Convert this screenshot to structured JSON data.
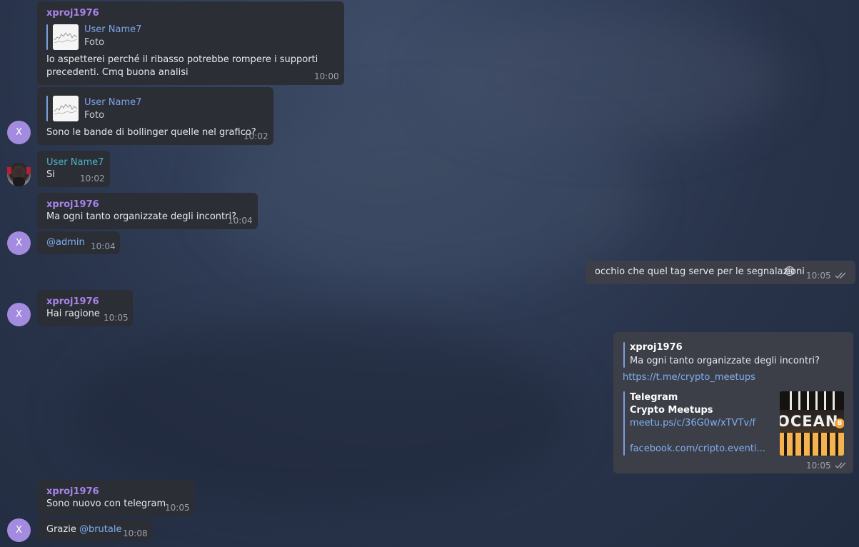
{
  "messages": {
    "m1": {
      "sender": "xproj1976",
      "reply_name": "User Name7",
      "reply_sub": "Foto",
      "line1": "Io aspetterei perché il ribasso potrebbe rompere i supporti",
      "line2": "precedenti. Cmq buona analisi",
      "time": "10:00"
    },
    "m2": {
      "reply_name": "User Name7",
      "reply_sub": "Foto",
      "text": "Sono le bande di bollinger quelle nel grafico?",
      "time": "10:02",
      "avatar": "X"
    },
    "m3": {
      "sender": "User Name7",
      "text": "Si",
      "time": "10:02"
    },
    "m4": {
      "sender": "xproj1976",
      "text": "Ma ogni tanto organizzate degli incontri?",
      "time": "10:04"
    },
    "m5": {
      "text": "@admin",
      "time": "10:04",
      "avatar": "X"
    },
    "m6": {
      "text": "occhio che quel tag serve per le segnalazioni",
      "emoji": "😄",
      "time": "10:05"
    },
    "m7": {
      "sender": "xproj1976",
      "text": "Hai ragione",
      "time": "10:05",
      "avatar": "X"
    },
    "m8": {
      "reply_name": "xproj1976",
      "reply_text": "Ma ogni tanto organizzate degli incontri?",
      "link": "https://t.me/crypto_meetups",
      "preview_site": "Telegram",
      "preview_title": "Crypto Meetups",
      "preview_link1": "meetu.ps/c/36G0w/xTVTv/f",
      "preview_link2": "facebook.com/cripto.eventi...",
      "preview_image_text": "OCEAN",
      "preview_badge": "B",
      "time": "10:05"
    },
    "m9": {
      "sender": "xproj1976",
      "text": "Sono nuovo con telegram",
      "time": "10:05"
    },
    "m10": {
      "text_prefix": "Grazie ",
      "mention": "@brutale",
      "time": "10:08",
      "avatar": "X"
    }
  },
  "colors": {
    "incoming_bubble": "#2c2e36",
    "outgoing_bubble": "#3c3f48",
    "sender_purple": "#a784e8",
    "sender_teal": "#4ab3c9",
    "link": "#7fb0f0",
    "avatar": "#a38be0"
  },
  "icons": {
    "read_ticks": "double-check-icon",
    "reply_thumbnail": "photo-thumbnail-icon"
  }
}
